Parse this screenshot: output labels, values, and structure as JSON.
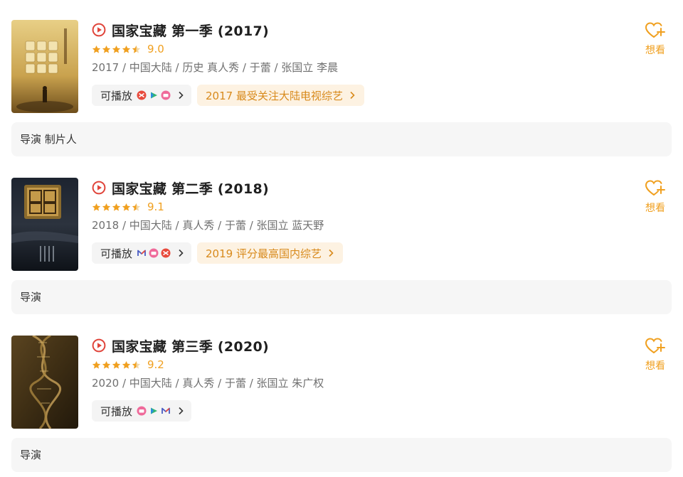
{
  "items": [
    {
      "title": "国家宝藏 第一季 (2017)",
      "score": "9.0",
      "meta": "2017 / 中国大陆 / 历史 真人秀 / 于蕾 / 张国立 李晨",
      "play_label": "可播放",
      "platforms": [
        "platform-a-icon",
        "platform-b-icon",
        "platform-c-icon"
      ],
      "award": "2017 最受关注大陆电视综艺",
      "wish_label": "想看",
      "roles": "导演 制片人"
    },
    {
      "title": "国家宝藏 第二季 (2018)",
      "score": "9.1",
      "meta": "2018 / 中国大陆 / 真人秀 / 于蕾 / 张国立 蓝天野",
      "play_label": "可播放",
      "platforms": [
        "platform-d-icon",
        "platform-c-icon",
        "platform-a-icon"
      ],
      "award": "2019 评分最高国内综艺",
      "wish_label": "想看",
      "roles": "导演"
    },
    {
      "title": "国家宝藏 第三季 (2020)",
      "score": "9.2",
      "meta": "2020 / 中国大陆 / 真人秀 / 于蕾 / 张国立 朱广权",
      "play_label": "可播放",
      "platforms": [
        "platform-c-icon",
        "platform-b-icon",
        "platform-d-icon"
      ],
      "award": "",
      "wish_label": "想看",
      "roles": "导演"
    }
  ],
  "colors": {
    "accent": "#f0a020",
    "award_bg": "#fdf2e2",
    "award_text": "#d88a1c",
    "play_red": "#e0443a"
  }
}
